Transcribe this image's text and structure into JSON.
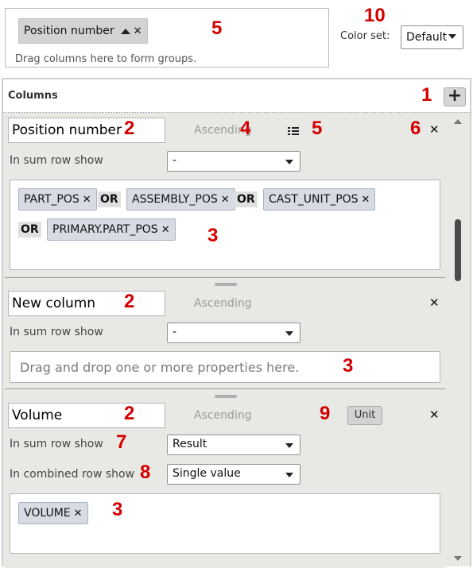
{
  "group_bar": {
    "chip_label": "Position number",
    "hint": "Drag columns here to form groups.",
    "color_set_label": "Color set:",
    "color_set_value": "Default"
  },
  "columns_panel": {
    "title": "Columns",
    "add_label": "+",
    "sections": [
      {
        "name": "Position number",
        "sort": "Ascending",
        "sum_row_label": "In sum row show",
        "sum_row_value": "-",
        "properties": [
          "PART_POS",
          "ASSEMBLY_POS",
          "CAST_UNIT_POS",
          "PRIMARY.PART_POS"
        ],
        "or_label": "OR"
      },
      {
        "name": "New column",
        "sort": "Ascending",
        "sum_row_label": "In sum row show",
        "sum_row_value": "-",
        "drop_hint": "Drag and drop one or more properties here."
      },
      {
        "name": "Volume",
        "sort": "Ascending",
        "unit_label": "Unit",
        "sum_row_label": "In sum row show",
        "sum_row_value": "Result",
        "combined_row_label": "In combined row show",
        "combined_row_value": "Single value",
        "properties": [
          "VOLUME"
        ]
      }
    ]
  },
  "callouts": {
    "n1": "1",
    "n2a": "2",
    "n2b": "2",
    "n2c": "2",
    "n3a": "3",
    "n3b": "3",
    "n3c": "3",
    "n4": "4",
    "n5a": "5",
    "n5b": "5",
    "n6": "6",
    "n7": "7",
    "n8": "8",
    "n9": "9",
    "n10": "10"
  },
  "colors": {
    "callout": "#d40000",
    "chip_bg": "#d6dbe4",
    "panel_bg": "#e8e8e4"
  }
}
